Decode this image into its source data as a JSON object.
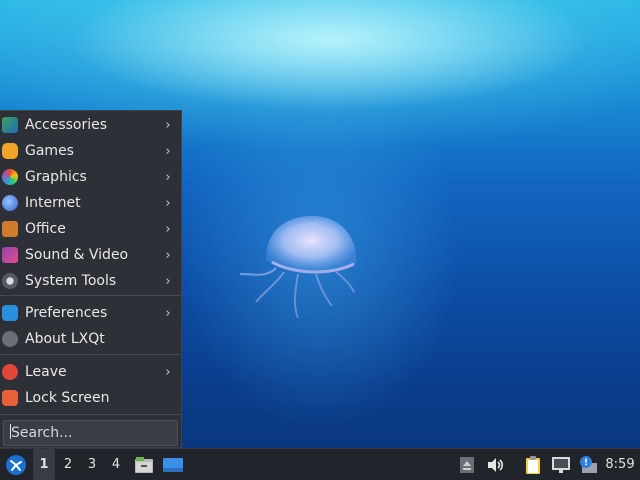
{
  "menu": {
    "items": [
      {
        "label": "Accessories",
        "icon": "accessories-icon",
        "submenu": true
      },
      {
        "label": "Games",
        "icon": "games-icon",
        "submenu": true
      },
      {
        "label": "Graphics",
        "icon": "graphics-icon",
        "submenu": true
      },
      {
        "label": "Internet",
        "icon": "internet-icon",
        "submenu": true
      },
      {
        "label": "Office",
        "icon": "office-icon",
        "submenu": true
      },
      {
        "label": "Sound & Video",
        "icon": "sound-video-icon",
        "submenu": true
      },
      {
        "label": "System Tools",
        "icon": "system-tools-icon",
        "submenu": true
      },
      {
        "label": "Preferences",
        "icon": "preferences-icon",
        "submenu": true
      },
      {
        "label": "About LXQt",
        "icon": "info-icon",
        "submenu": false
      },
      {
        "label": "Leave",
        "icon": "power-icon",
        "submenu": true
      },
      {
        "label": "Lock Screen",
        "icon": "lock-icon",
        "submenu": false
      }
    ],
    "search_placeholder": "Search...",
    "submenu_arrow": "›"
  },
  "taskbar": {
    "desktops": [
      "1",
      "2",
      "3",
      "4"
    ],
    "active_desktop": "1",
    "clock": "8:59"
  },
  "colors": {
    "menu_bg": "#2e3038",
    "taskbar_bg": "#22242b",
    "accent": "#2b8fe0"
  }
}
